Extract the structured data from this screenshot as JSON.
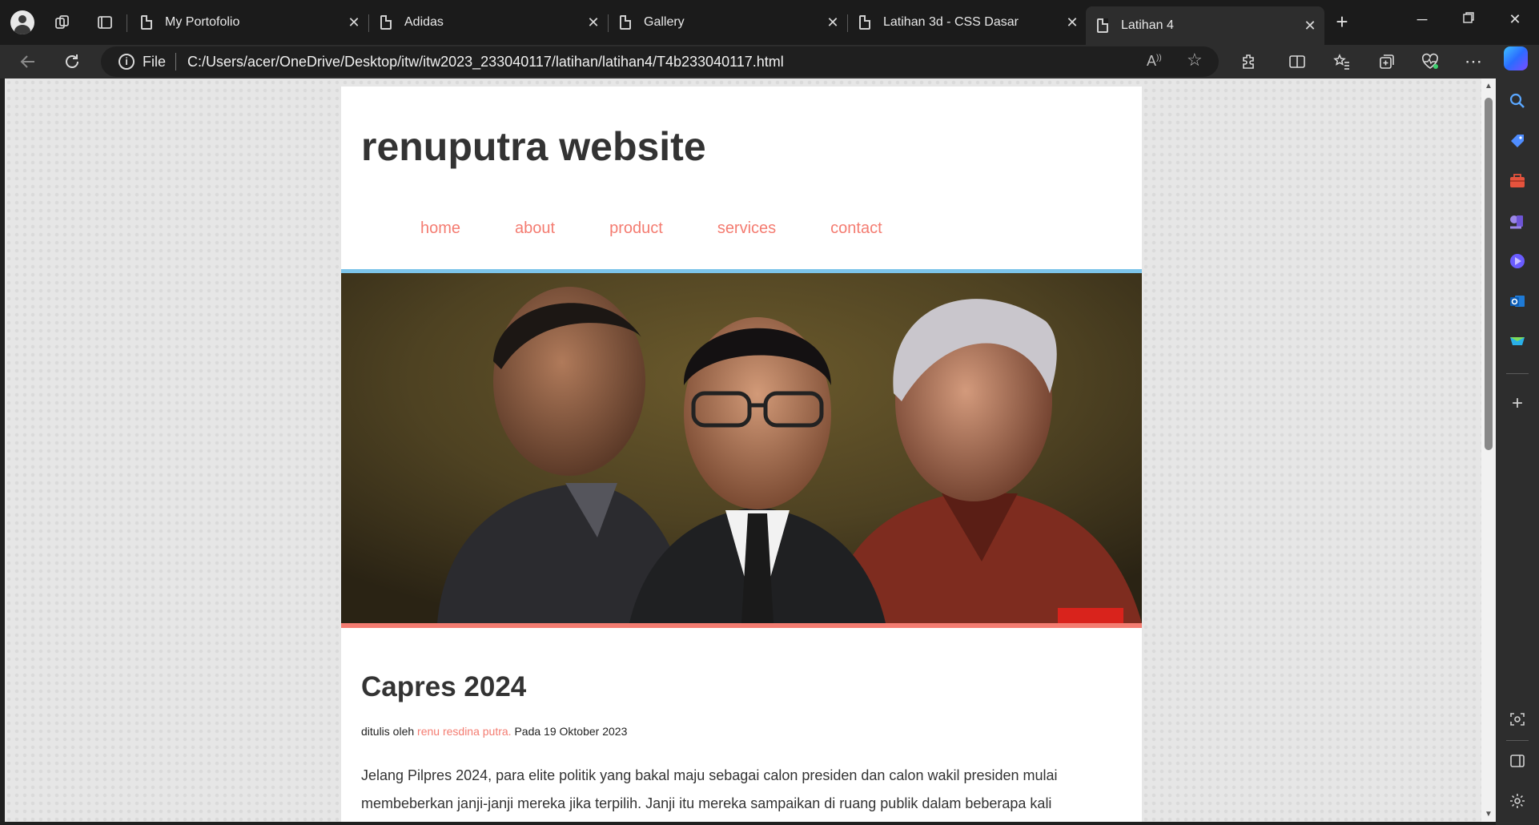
{
  "browser": {
    "tabs": [
      {
        "title": "My Portofolio",
        "active": false
      },
      {
        "title": "Adidas",
        "active": false
      },
      {
        "title": "Gallery",
        "active": false
      },
      {
        "title": "Latihan 3d - CSS Dasar",
        "active": false
      },
      {
        "title": "Latihan 4",
        "active": true
      }
    ],
    "address": {
      "scheme": "File",
      "url": "C:/Users/acer/OneDrive/Desktop/itw/itw2023_233040117/latihan/latihan4/T4b233040117.html"
    }
  },
  "page": {
    "site_title": "renuputra website",
    "menu": [
      "home",
      "about",
      "product",
      "services",
      "contact"
    ],
    "article": {
      "title": "Capres 2024",
      "byline_prefix": "ditulis oleh ",
      "author": "renu resdina putra.",
      "byline_suffix": " Pada 19 Oktober 2023",
      "body": "Jelang Pilpres 2024, para elite politik yang bakal maju sebagai calon presiden dan calon wakil presiden mulai membeberkan janji-janji mereka jika terpilih. Janji itu mereka sampaikan di ruang publik dalam beberapa kali kesempatan."
    }
  },
  "colors": {
    "accent": "#f47c71",
    "hero_top_border": "#7cc4ea"
  }
}
